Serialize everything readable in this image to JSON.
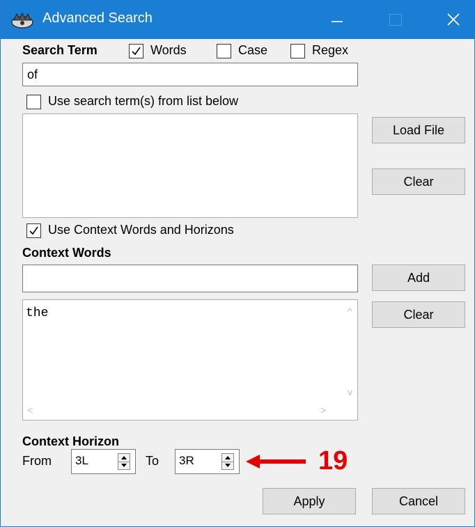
{
  "window": {
    "title": "Advanced Search",
    "minimize_icon": "minimize-icon",
    "maximize_icon": "maximize-icon",
    "close_icon": "close-icon",
    "title_bar_color": "#1a7fd4"
  },
  "search": {
    "label": "Search Term",
    "words_label": "Words",
    "words_checked": true,
    "case_label": "Case",
    "case_checked": false,
    "regex_label": "Regex",
    "regex_checked": false,
    "term_value": "of",
    "use_list_label": "Use search term(s) from list below",
    "use_list_checked": false,
    "list_items": [],
    "load_file_label": "Load File",
    "clear_label": "Clear"
  },
  "context": {
    "use_context_label": "Use Context Words and Horizons",
    "use_context_checked": true,
    "words_label": "Context Words",
    "input_value": "",
    "add_label": "Add",
    "clear_label": "Clear",
    "words_list": [
      "the"
    ]
  },
  "horizon": {
    "label": "Context Horizon",
    "from_label": "From",
    "from_value": "3L",
    "to_label": "To",
    "to_value": "3R"
  },
  "annotation": {
    "number": "19",
    "color": "#e60000"
  },
  "buttons": {
    "apply_label": "Apply",
    "cancel_label": "Cancel"
  }
}
